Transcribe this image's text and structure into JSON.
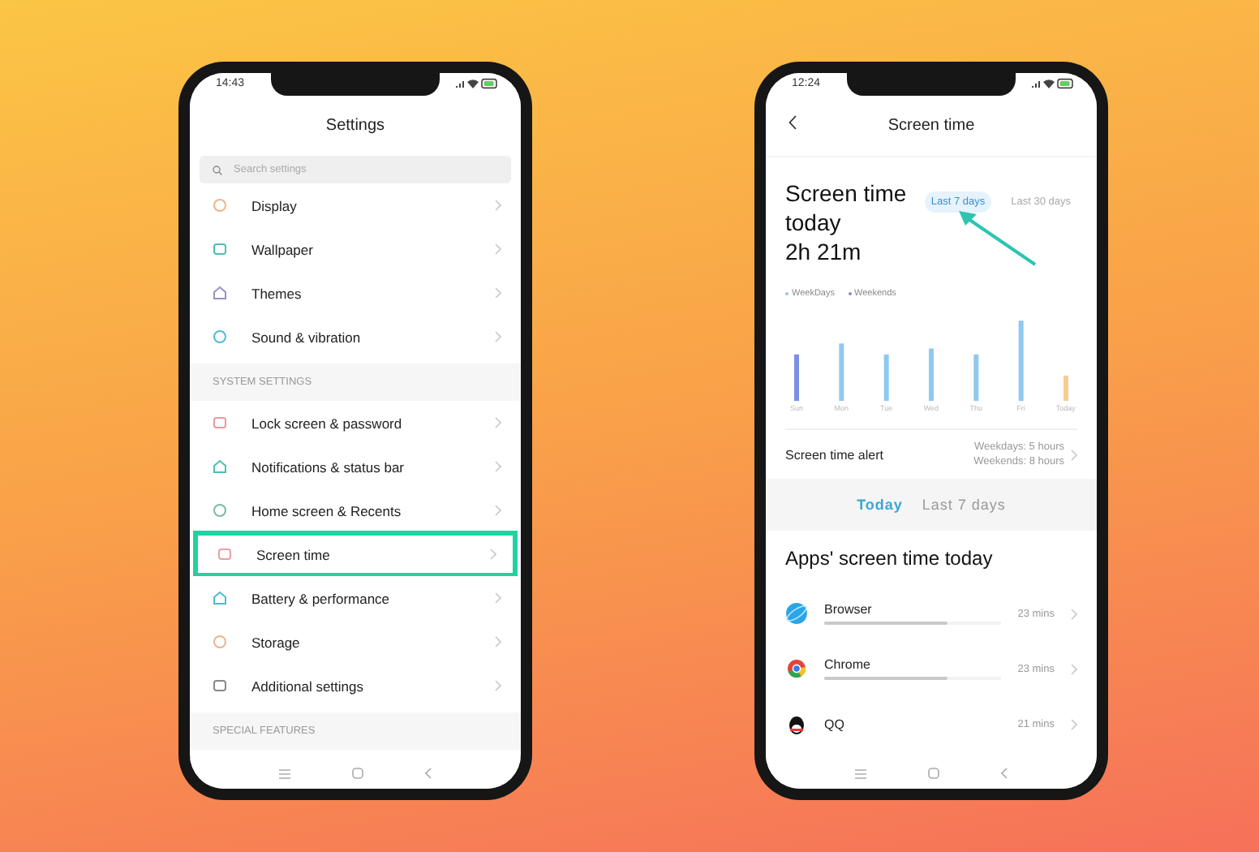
{
  "settings_phone": {
    "status_time": "14:43",
    "title": "Settings",
    "search": {
      "placeholder": "Search settings"
    },
    "sections": [
      {
        "items": [
          {
            "label": "Display",
            "highlighted": false
          },
          {
            "label": "Wallpaper",
            "highlighted": false
          },
          {
            "label": "Themes",
            "highlighted": false
          },
          {
            "label": "Sound & vibration",
            "highlighted": false
          }
        ]
      },
      {
        "header": "SYSTEM SETTINGS",
        "items": [
          {
            "label": "Lock screen & password",
            "highlighted": false
          },
          {
            "label": "Notifications & status bar",
            "highlighted": false
          },
          {
            "label": "Home screen & Recents",
            "highlighted": false
          },
          {
            "label": "Screen time",
            "highlighted": true
          },
          {
            "label": "Battery & performance",
            "highlighted": false
          },
          {
            "label": "Storage",
            "highlighted": false
          },
          {
            "label": "Additional settings",
            "highlighted": false
          }
        ]
      },
      {
        "header": "SPECIAL FEATURES"
      }
    ]
  },
  "screen_time_phone": {
    "status_time": "12:24",
    "title": "Screen time",
    "summary": [
      "Screen time",
      "today",
      "2h 21m"
    ],
    "range_tabs": [
      {
        "label": "Last 7 days",
        "selected": true
      },
      {
        "label": "Last 30 days",
        "selected": false
      }
    ],
    "legend": [
      {
        "label": "WeekDays",
        "color": "#8ec9ef"
      },
      {
        "label": "Weekends",
        "color": "#7d8fe0"
      }
    ],
    "days": [
      {
        "label": "Sun",
        "color": "#7d8fe0"
      },
      {
        "label": "Mon",
        "color": "#8ec9ef"
      },
      {
        "label": "Tue",
        "color": "#8ec9ef"
      },
      {
        "label": "Wed",
        "color": "#8ec9ef"
      },
      {
        "label": "Thu",
        "color": "#8ec9ef"
      },
      {
        "label": "Fri",
        "color": "#8ec9ef"
      },
      {
        "label": "Today",
        "color": "#f5cf8e"
      }
    ],
    "alert": {
      "label": "Screen time alert",
      "lines": [
        "Weekdays: 5 hours",
        "Weekends: 8 hours"
      ]
    },
    "view_tabs": [
      {
        "label": "Today",
        "selected": true
      },
      {
        "label": "Last 7 days",
        "selected": false
      }
    ],
    "apps_heading": "Apps' screen time today",
    "apps": [
      {
        "name": "Browser",
        "level": 0.7,
        "time": "23 mins"
      },
      {
        "name": "Chrome",
        "level": 0.7,
        "time": "23 mins"
      },
      {
        "name": "QQ",
        "time": "21 mins"
      }
    ]
  }
}
